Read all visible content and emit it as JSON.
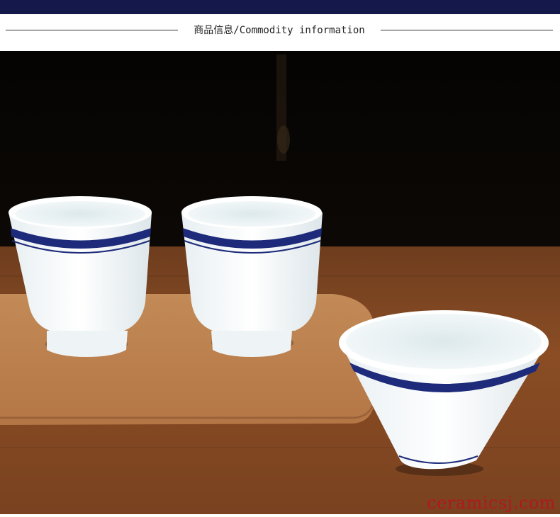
{
  "header": {
    "title": "商品信息/Commodity information"
  },
  "photo": {
    "subject": "three-white-porcelain-tea-cups-with-blue-rim-bands-on-wooden-tray",
    "watermark": "ceramicsj.com"
  },
  "colors": {
    "top_bar": "#14184a",
    "background": "#ffffff",
    "accent_blue": "#1d2b7a",
    "watermark_red": "#b3171d"
  }
}
